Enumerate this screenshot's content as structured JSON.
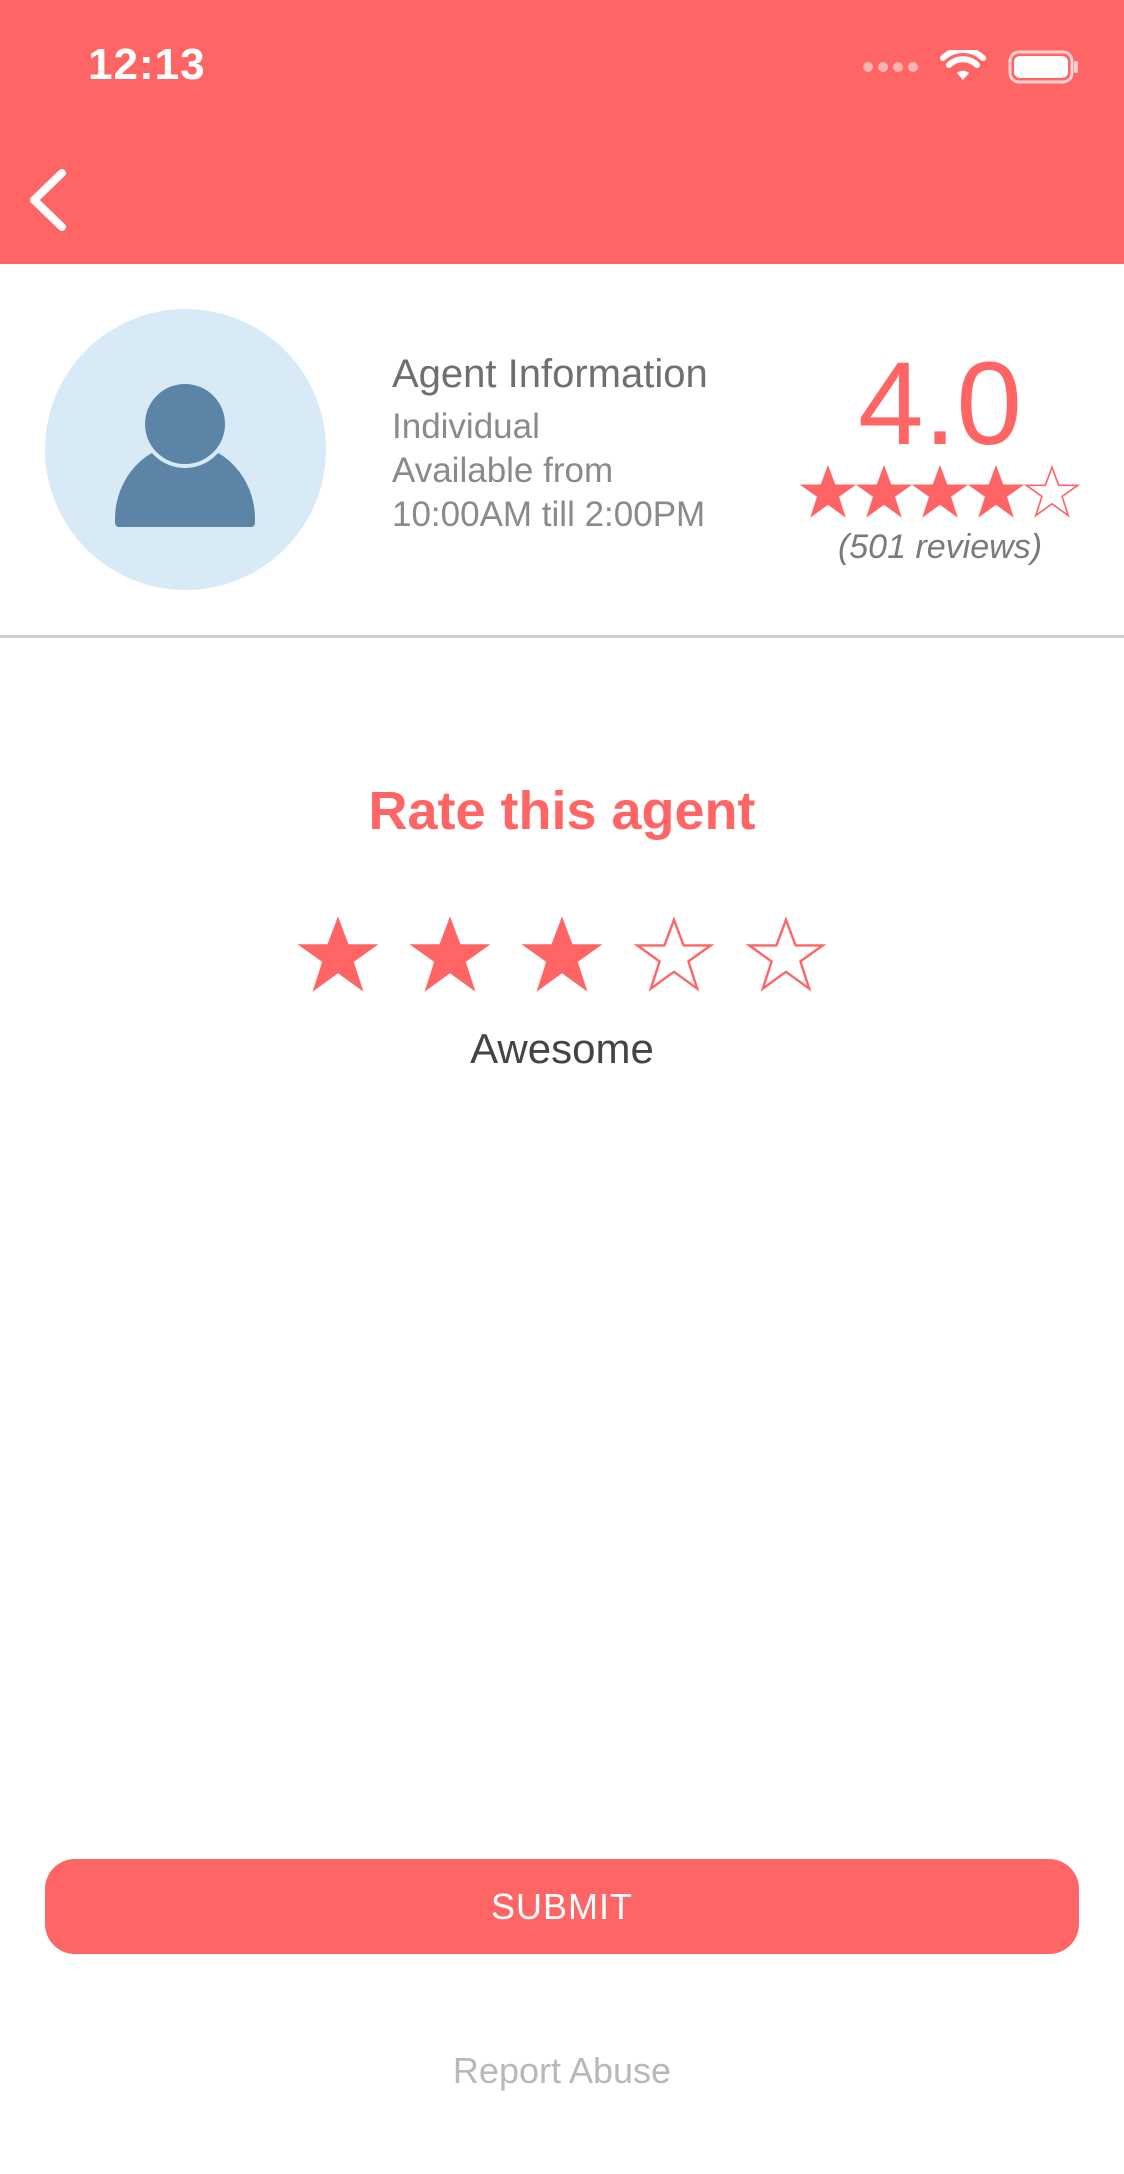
{
  "status_bar": {
    "time": "12:13"
  },
  "nav": {
    "back_icon": "chevron-left-icon"
  },
  "agent": {
    "avatar_icon": "person-icon",
    "title": "Agent Information",
    "type": "Individual",
    "availability_line1": "Available from",
    "availability_line2": "10:00AM till 2:00PM",
    "rating": "4.0",
    "rating_stars_filled": 4,
    "rating_stars_total": 5,
    "reviews": "(501 reviews)"
  },
  "rate": {
    "title": "Rate this agent",
    "selected_stars": 3,
    "total_stars": 5,
    "label": "Awesome"
  },
  "actions": {
    "submit_label": "SUBMIT",
    "report_label": "Report Abuse"
  },
  "colors": {
    "accent": "#ff6565",
    "avatar_bg": "#d9eaf7",
    "avatar_fg": "#5b84a6",
    "divider": "#cfcfcf"
  }
}
